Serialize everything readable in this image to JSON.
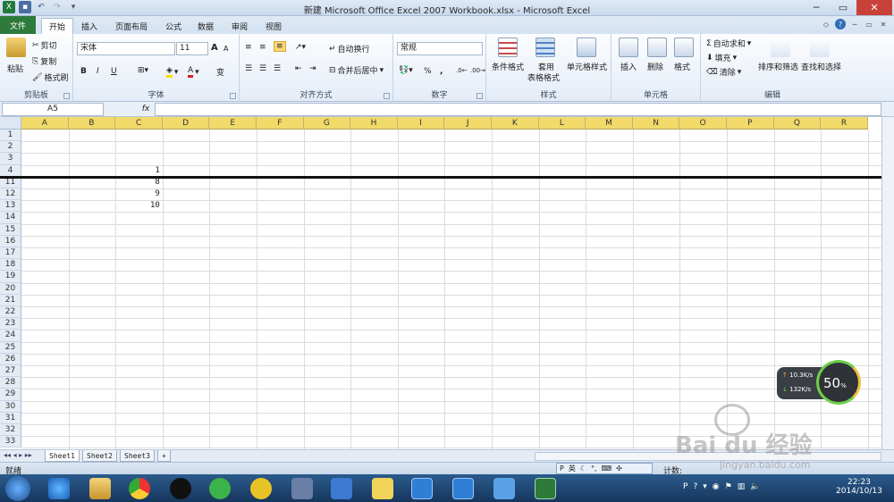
{
  "title": "新建 Microsoft Office Excel 2007 Workbook.xlsx - Microsoft Excel",
  "tabs": [
    "文件",
    "开始",
    "插入",
    "页面布局",
    "公式",
    "数据",
    "审阅",
    "视图"
  ],
  "clipboard": {
    "paste": "粘贴",
    "cut": "剪切",
    "copy": "复制",
    "format_painter": "格式刷",
    "label": "剪贴板"
  },
  "font": {
    "name": "宋体",
    "size": "11",
    "label": "字体",
    "bold": "B",
    "italic": "I",
    "underline": "U",
    "grow": "A",
    "shrink": "A",
    "phonetic": "变"
  },
  "alignment": {
    "wrap": "自动换行",
    "merge": "合并后居中",
    "label": "对齐方式"
  },
  "number": {
    "format": "常规",
    "percent": "%",
    "comma": ",",
    "label": "数字"
  },
  "styles": {
    "conditional": "条件格式",
    "table1": "套用",
    "table2": "表格格式",
    "cell_styles": "单元格样式",
    "label": "样式"
  },
  "cells": {
    "insert": "插入",
    "delete": "删除",
    "format": "格式",
    "label": "单元格"
  },
  "editing": {
    "autosum": "自动求和",
    "fill": "填充",
    "clear": "清除",
    "sort": "排序和筛选",
    "find": "查找和选择",
    "label": "编辑"
  },
  "formula_bar": {
    "name_box": "A5",
    "fx": "fx",
    "value": ""
  },
  "columns": [
    "A",
    "B",
    "C",
    "D",
    "E",
    "F",
    "G",
    "H",
    "I",
    "J",
    "K",
    "L",
    "M",
    "N",
    "O",
    "P",
    "Q",
    "R"
  ],
  "rows": [
    "1",
    "2",
    "3",
    "4",
    "11",
    "12",
    "13",
    "14",
    "15",
    "16",
    "17",
    "18",
    "19",
    "20",
    "21",
    "22",
    "23",
    "24",
    "25",
    "26",
    "27",
    "28",
    "29",
    "30",
    "31",
    "32",
    "33"
  ],
  "cell_values": {
    "C4": "1",
    "C11": "8",
    "C12": "9",
    "C13": "10"
  },
  "sheets": [
    "Sheet1",
    "Sheet2",
    "Sheet3"
  ],
  "status": {
    "ready": "就绪",
    "count": "计数:"
  },
  "speed_widget": {
    "up": "10.3K/s",
    "down": "132K/s",
    "percent": "50",
    "unit": "%"
  },
  "clock": {
    "time": "22:23",
    "date": "2014/10/13"
  },
  "ime": "英",
  "watermark": "Bai du 经验",
  "watermark_url": "jingyan.baidu.com"
}
